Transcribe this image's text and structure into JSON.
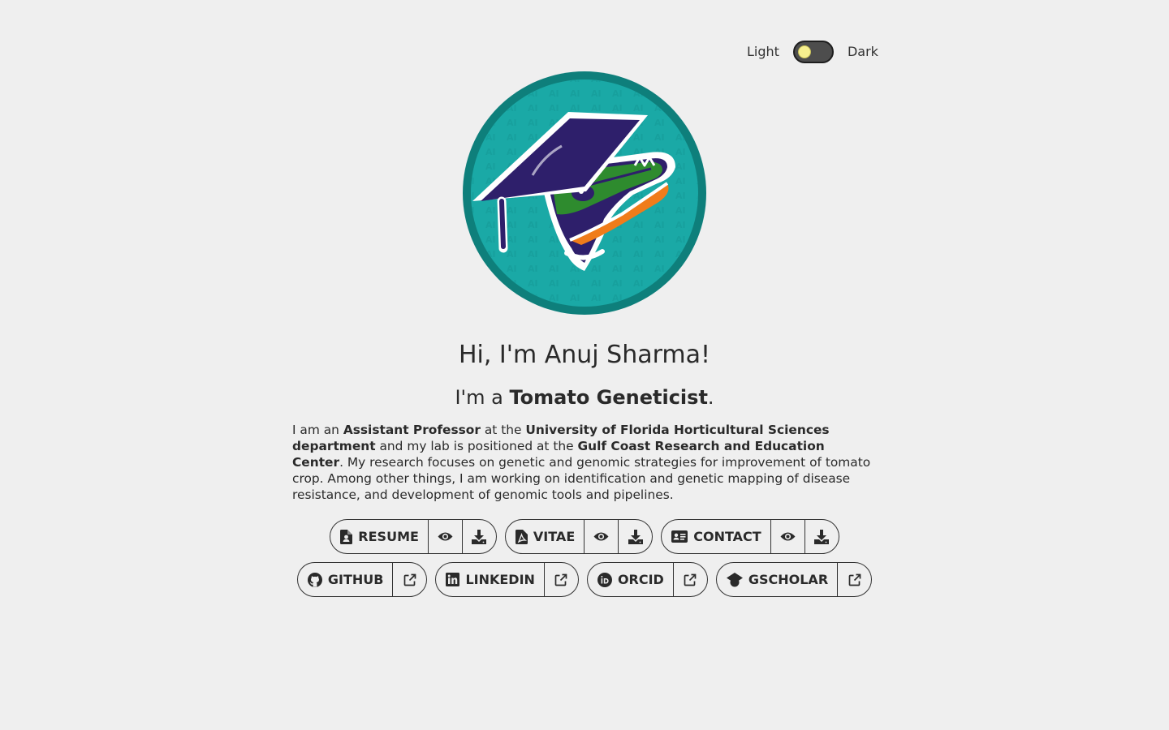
{
  "theme": {
    "light_label": "Light",
    "dark_label": "Dark",
    "mode": "light"
  },
  "avatar": {
    "icon": "gator-graduation-cap-logo",
    "pattern_text": "AI"
  },
  "hero": {
    "name": "Hi, I'm Anuj Sharma!",
    "role_prefix": "I'm a ",
    "role": "Tomato Geneticist",
    "role_suffix": "."
  },
  "bio": {
    "t1": "I am an ",
    "b1": "Assistant Professor",
    "t2": " at the ",
    "b2": "University of Florida Horticultural Sciences department",
    "t3": " and my lab is positioned at the ",
    "b3": "Gulf Coast Research and Education Center",
    "t4": ". My research focuses on genetic and genomic strategies for improvement of tomato crop. Among other things, I am working on identification and genetic mapping of disease resistance, and development of genomic tools and pipelines."
  },
  "documents": [
    {
      "label": "RESUME",
      "icon": "file-user-icon",
      "actions": [
        "eye-icon",
        "download-icon"
      ]
    },
    {
      "label": "VITAE",
      "icon": "file-pdf-icon",
      "actions": [
        "eye-icon",
        "download-icon"
      ]
    },
    {
      "label": "CONTACT",
      "icon": "address-card-icon",
      "actions": [
        "eye-icon",
        "download-icon"
      ]
    }
  ],
  "profiles": [
    {
      "label": "GITHUB",
      "icon": "github-icon",
      "action": "external-link-icon"
    },
    {
      "label": "LINKEDIN",
      "icon": "linkedin-icon",
      "action": "external-link-icon"
    },
    {
      "label": "ORCID",
      "icon": "orcid-icon",
      "action": "external-link-icon"
    },
    {
      "label": "GSCHOLAR",
      "icon": "graduation-cap-icon",
      "action": "external-link-icon"
    }
  ],
  "colors": {
    "background": "#efefef",
    "text": "#2a2a2a",
    "avatar_ring": "#0e7f7b",
    "avatar_fill": "#1aa9a6",
    "cap": "#2e1f6b",
    "gator_green": "#2e8b2e",
    "gator_orange": "#f07c1a",
    "toggle_knob": "#f7f08f"
  }
}
